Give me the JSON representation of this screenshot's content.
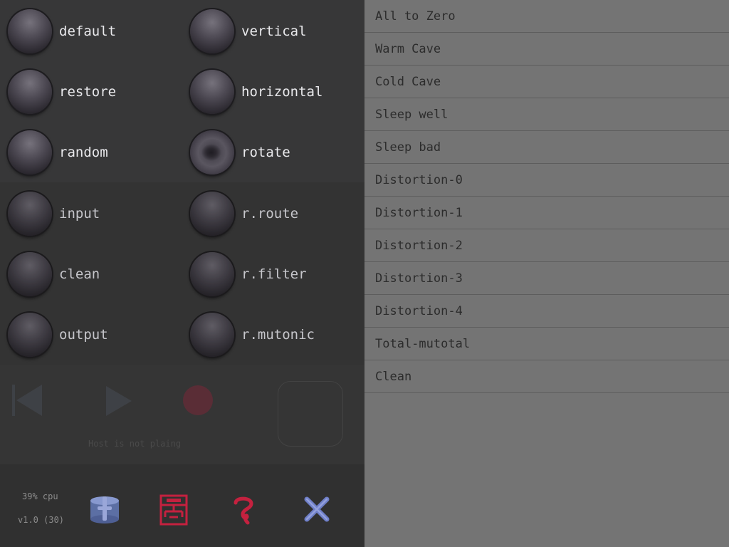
{
  "presets": {
    "default": "default",
    "restore": "restore",
    "random": "random",
    "input": "input",
    "clean": "clean",
    "output": "output",
    "vertical": "vertical",
    "horizontal": "horizontal",
    "rotate": "rotate",
    "r_route": "r.route",
    "r_filter": "r.filter",
    "r_mutonic": "r.mutonic"
  },
  "transport": {
    "host_status": "Host is not plaing"
  },
  "status": {
    "cpu": "39% cpu",
    "version": "v1.0 (30)"
  },
  "icons": {
    "rewind": "rewind-icon",
    "play": "play-icon",
    "record": "record-icon",
    "database": "database-icon",
    "grid": "grid-icon",
    "help": "help-icon",
    "close": "close-icon"
  },
  "colors": {
    "accent_red": "#c4213f",
    "accent_blue": "#6f7fc8",
    "list_bg": "#747474"
  },
  "preset_list": [
    "All to Zero",
    "Warm Cave",
    "Cold Cave",
    "Sleep well",
    "Sleep bad",
    "Distortion-0",
    "Distortion-1",
    "Distortion-2",
    "Distortion-3",
    "Distortion-4",
    "Total-mutotal",
    "Clean"
  ]
}
